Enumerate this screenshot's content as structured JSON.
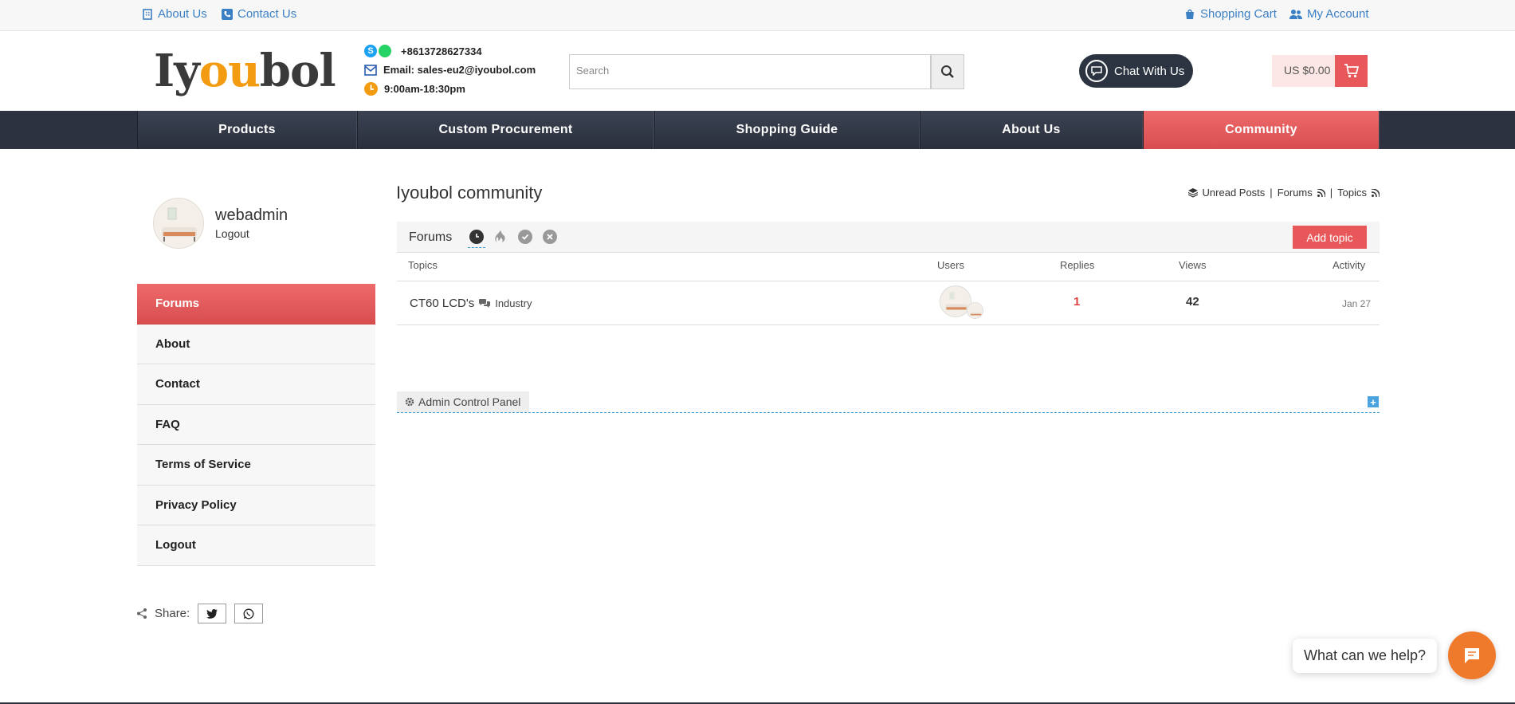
{
  "topbar": {
    "about_us": "About Us",
    "contact_us": "Contact Us",
    "shopping_cart": "Shopping Cart",
    "my_account": "My Account"
  },
  "header": {
    "logo_text_parts": [
      "Iy",
      "ou",
      "bol"
    ],
    "phone": "+8613728627334",
    "email": "Email: sales-eu2@iyoubol.com",
    "hours": "9:00am-18:30pm",
    "search_placeholder": "Search",
    "chat_label": "Chat With Us",
    "cart_total": "US $0.00"
  },
  "nav": {
    "items": [
      {
        "label": "Products"
      },
      {
        "label": "Custom Procurement"
      },
      {
        "label": "Shopping Guide"
      },
      {
        "label": "About Us"
      },
      {
        "label": "Community",
        "active": true
      }
    ]
  },
  "sidebar": {
    "username": "webadmin",
    "logout_link": "Logout",
    "menu": [
      {
        "label": "Forums",
        "active": true
      },
      {
        "label": "About"
      },
      {
        "label": "Contact"
      },
      {
        "label": "FAQ"
      },
      {
        "label": "Terms of Service"
      },
      {
        "label": "Privacy Policy"
      },
      {
        "label": "Logout"
      }
    ],
    "share_label": "Share:"
  },
  "main": {
    "title": "Iyoubol community",
    "links": {
      "unread": "Unread Posts",
      "forums": "Forums",
      "topics": "Topics",
      "sep": "|"
    },
    "forums_label": "Forums",
    "add_topic": "Add topic",
    "columns": {
      "topics": "Topics",
      "users": "Users",
      "replies": "Replies",
      "views": "Views",
      "activity": "Activity"
    },
    "topic": {
      "title": "CT60 LCD's",
      "category": "Industry",
      "replies": "1",
      "views": "42",
      "activity": "Jan 27"
    },
    "admin_panel": "Admin Control Panel",
    "plus": "+"
  },
  "widget": {
    "help_text": "What can we help?"
  },
  "colors": {
    "accent_red": "#e8585a",
    "nav_dark": "#2c3240",
    "link_blue": "#3b7fc4",
    "logo_orange": "#f39c12",
    "chat_orange": "#f07a2c"
  }
}
